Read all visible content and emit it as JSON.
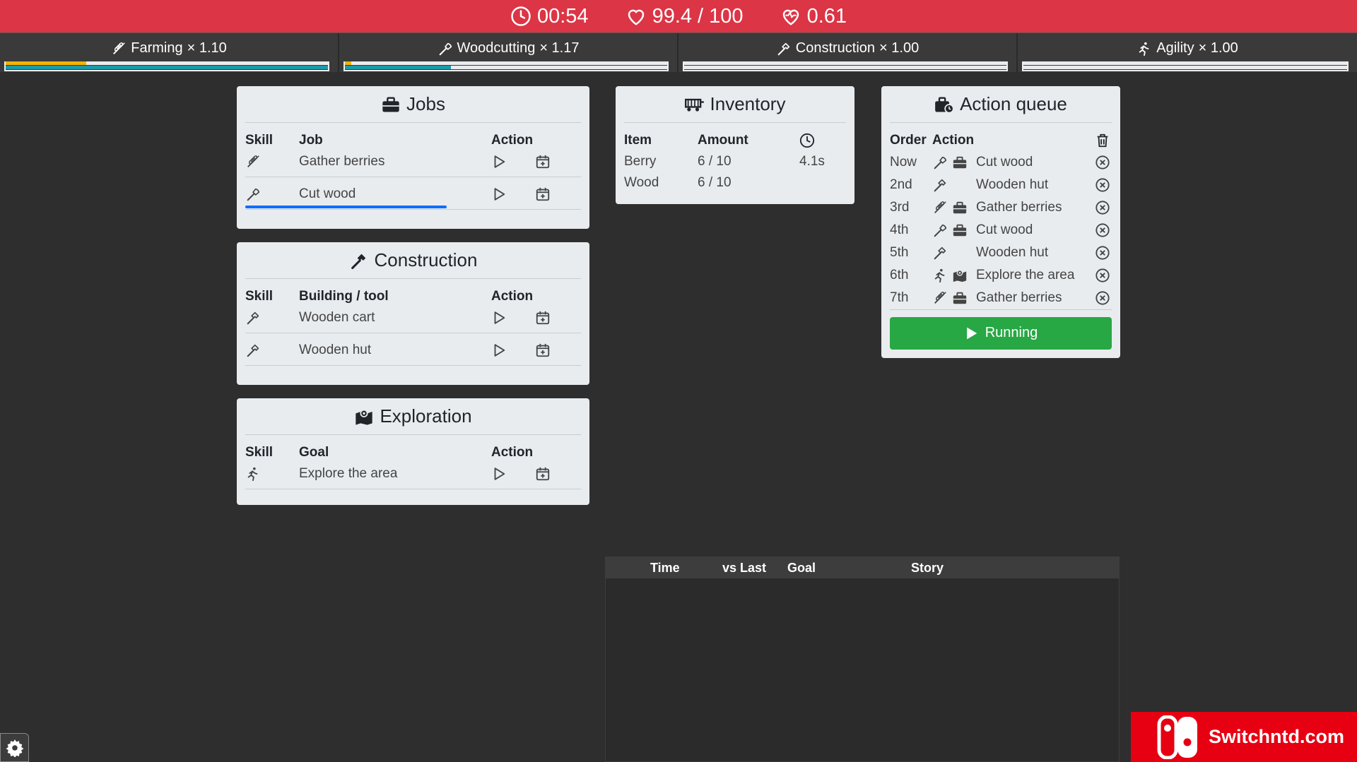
{
  "status": {
    "time": "00:54",
    "health": "99.4 / 100",
    "health_rate": "0.61"
  },
  "skills": [
    {
      "name": "Farming",
      "mult": "× 1.10",
      "bar1": 0.25,
      "bar2": 1.0
    },
    {
      "name": "Woodcutting",
      "mult": "× 1.17",
      "bar1": 0.02,
      "bar2": 0.33
    },
    {
      "name": "Construction",
      "mult": "× 1.00",
      "bar1": 0,
      "bar2": 0
    },
    {
      "name": "Agility",
      "mult": "× 1.00",
      "bar1": 0,
      "bar2": 0
    }
  ],
  "jobs": {
    "title": "Jobs",
    "headers": {
      "skill": "Skill",
      "job": "Job",
      "action": "Action"
    },
    "rows": [
      {
        "name": "Gather berries",
        "skill_icon": "farming-icon",
        "progress": 0
      },
      {
        "name": "Cut wood",
        "skill_icon": "woodcutting-icon",
        "progress": 0.6
      }
    ]
  },
  "construction": {
    "title": "Construction",
    "headers": {
      "skill": "Skill",
      "building": "Building / tool",
      "action": "Action"
    },
    "rows": [
      {
        "name": "Wooden cart",
        "skill_icon": "hammer-icon"
      },
      {
        "name": "Wooden hut",
        "skill_icon": "hammer-icon"
      }
    ]
  },
  "exploration": {
    "title": "Exploration",
    "headers": {
      "skill": "Skill",
      "goal": "Goal",
      "action": "Action"
    },
    "rows": [
      {
        "name": "Explore the area",
        "skill_icon": "running-icon"
      }
    ]
  },
  "inventory": {
    "title": "Inventory",
    "headers": {
      "item": "Item",
      "amount": "Amount"
    },
    "rows": [
      {
        "item": "Berry",
        "amount": "6 / 10",
        "time": "4.1s"
      },
      {
        "item": "Wood",
        "amount": "6 / 10",
        "time": ""
      }
    ]
  },
  "queue": {
    "title": "Action queue",
    "headers": {
      "order": "Order",
      "action": "Action"
    },
    "rows": [
      {
        "order": "Now",
        "action": "Cut wood",
        "icons": [
          "woodcutting-icon",
          "toolbox-icon"
        ]
      },
      {
        "order": "2nd",
        "action": "Wooden hut",
        "icons": [
          "hammer-icon"
        ]
      },
      {
        "order": "3rd",
        "action": "Gather berries",
        "icons": [
          "farming-icon",
          "toolbox-icon"
        ]
      },
      {
        "order": "4th",
        "action": "Cut wood",
        "icons": [
          "woodcutting-icon",
          "toolbox-icon"
        ]
      },
      {
        "order": "5th",
        "action": "Wooden hut",
        "icons": [
          "hammer-icon"
        ]
      },
      {
        "order": "6th",
        "action": "Explore the area",
        "icons": [
          "running-icon",
          "map-icon"
        ]
      },
      {
        "order": "7th",
        "action": "Gather berries",
        "icons": [
          "farming-icon",
          "toolbox-icon"
        ]
      }
    ],
    "running_label": "Running"
  },
  "story": {
    "headers": {
      "time": "Time",
      "vs_last": "vs Last",
      "goal": "Goal",
      "story": "Story"
    }
  },
  "watermark": {
    "text": "Switchntd.com"
  },
  "colors": {
    "topbar": "#dc3545",
    "running": "#28a745",
    "progress": "#0d6efd",
    "xp_yellow": "#f0b400",
    "xp_teal": "#1b9aaa"
  }
}
